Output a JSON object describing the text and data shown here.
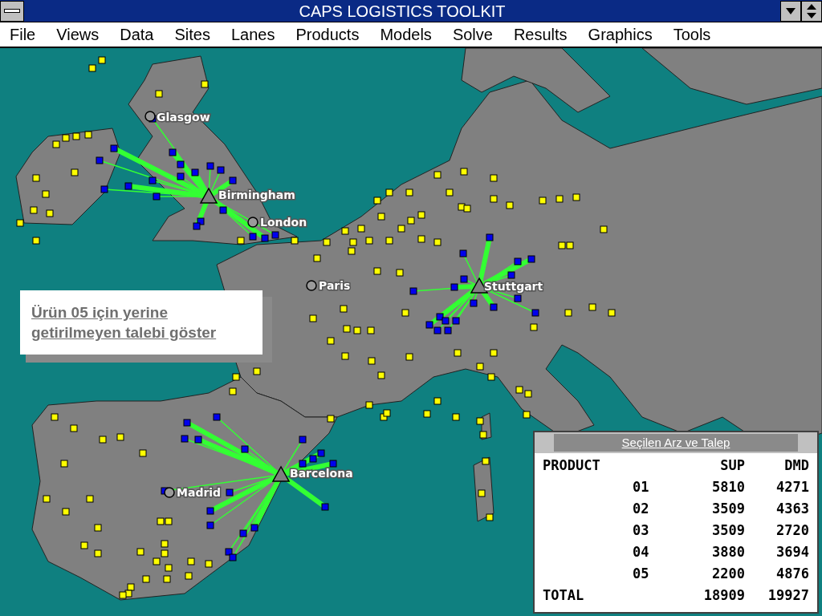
{
  "window": {
    "title": "CAPS LOGISTICS TOOLKIT"
  },
  "menu": [
    "File",
    "Views",
    "Data",
    "Sites",
    "Lanes",
    "Products",
    "Models",
    "Solve",
    "Results",
    "Graphics",
    "Tools"
  ],
  "sites": [
    {
      "label": "Glasgow",
      "kind": "city"
    },
    {
      "label": "Birmingham",
      "kind": "plant"
    },
    {
      "label": "London",
      "kind": "city"
    },
    {
      "label": "Paris",
      "kind": "city"
    },
    {
      "label": "Stuttgart",
      "kind": "plant"
    },
    {
      "label": "Madrid",
      "kind": "city"
    },
    {
      "label": "Barcelona",
      "kind": "plant"
    }
  ],
  "callout": {
    "text": "Ürün 05 için yerine getirilmeyen talebi göster"
  },
  "summary": {
    "title": "Seçilen Arz ve Talep",
    "columns": [
      "PRODUCT",
      "SUP",
      "DMD"
    ],
    "rows": [
      {
        "product": "01",
        "sup": "5810",
        "dmd": "4271"
      },
      {
        "product": "02",
        "sup": "3509",
        "dmd": "4363"
      },
      {
        "product": "03",
        "sup": "3509",
        "dmd": "2720"
      },
      {
        "product": "04",
        "sup": "3880",
        "dmd": "3694"
      },
      {
        "product": "05",
        "sup": "2200",
        "dmd": "4876"
      }
    ],
    "total": {
      "label": "TOTAL",
      "sup": "18909",
      "dmd": "19927"
    }
  }
}
